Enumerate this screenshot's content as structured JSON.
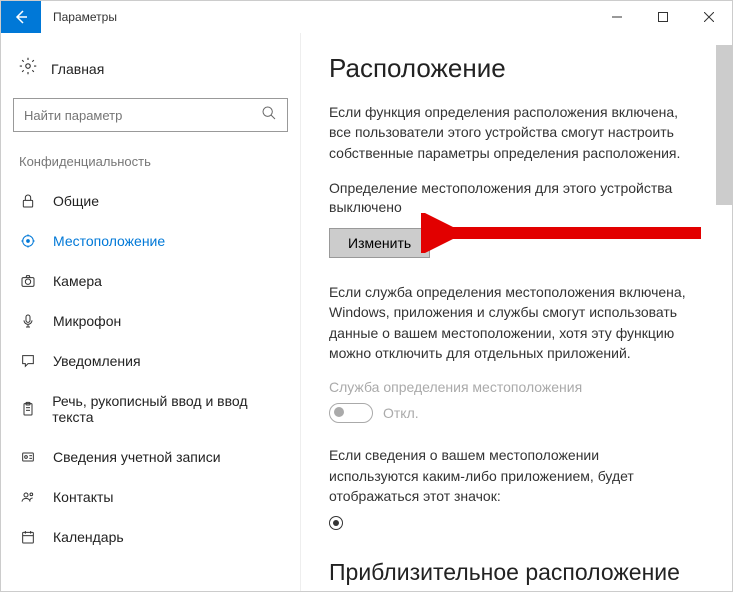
{
  "window": {
    "title": "Параметры"
  },
  "sidebar": {
    "home": "Главная",
    "search_placeholder": "Найти параметр",
    "section": "Конфиденциальность",
    "items": [
      {
        "label": "Общие",
        "icon": "lock"
      },
      {
        "label": "Местоположение",
        "icon": "location"
      },
      {
        "label": "Камера",
        "icon": "camera"
      },
      {
        "label": "Микрофон",
        "icon": "mic"
      },
      {
        "label": "Уведомления",
        "icon": "speech"
      },
      {
        "label": "Речь, рукописный ввод и ввод текста",
        "icon": "clipboard"
      },
      {
        "label": "Сведения учетной записи",
        "icon": "account"
      },
      {
        "label": "Контакты",
        "icon": "contacts"
      },
      {
        "label": "Календарь",
        "icon": "calendar"
      }
    ]
  },
  "content": {
    "heading": "Расположение",
    "para1": "Если функция определения расположения включена, все пользователи этого устройства смогут настроить собственные параметры определения расположения.",
    "device_status": "Определение местоположения для этого устройства выключено",
    "change_button": "Изменить",
    "para2": "Если служба определения местоположения включена, Windows, приложения и службы смогут использовать данные о вашем местоположении, хотя эту функцию можно отключить для отдельных приложений.",
    "service_label": "Служба определения местоположения",
    "toggle_state": "Откл.",
    "para3": "Если сведения о вашем местоположении используются каким-либо приложением, будет отображаться этот значок:",
    "heading2": "Приблизительное расположение"
  }
}
